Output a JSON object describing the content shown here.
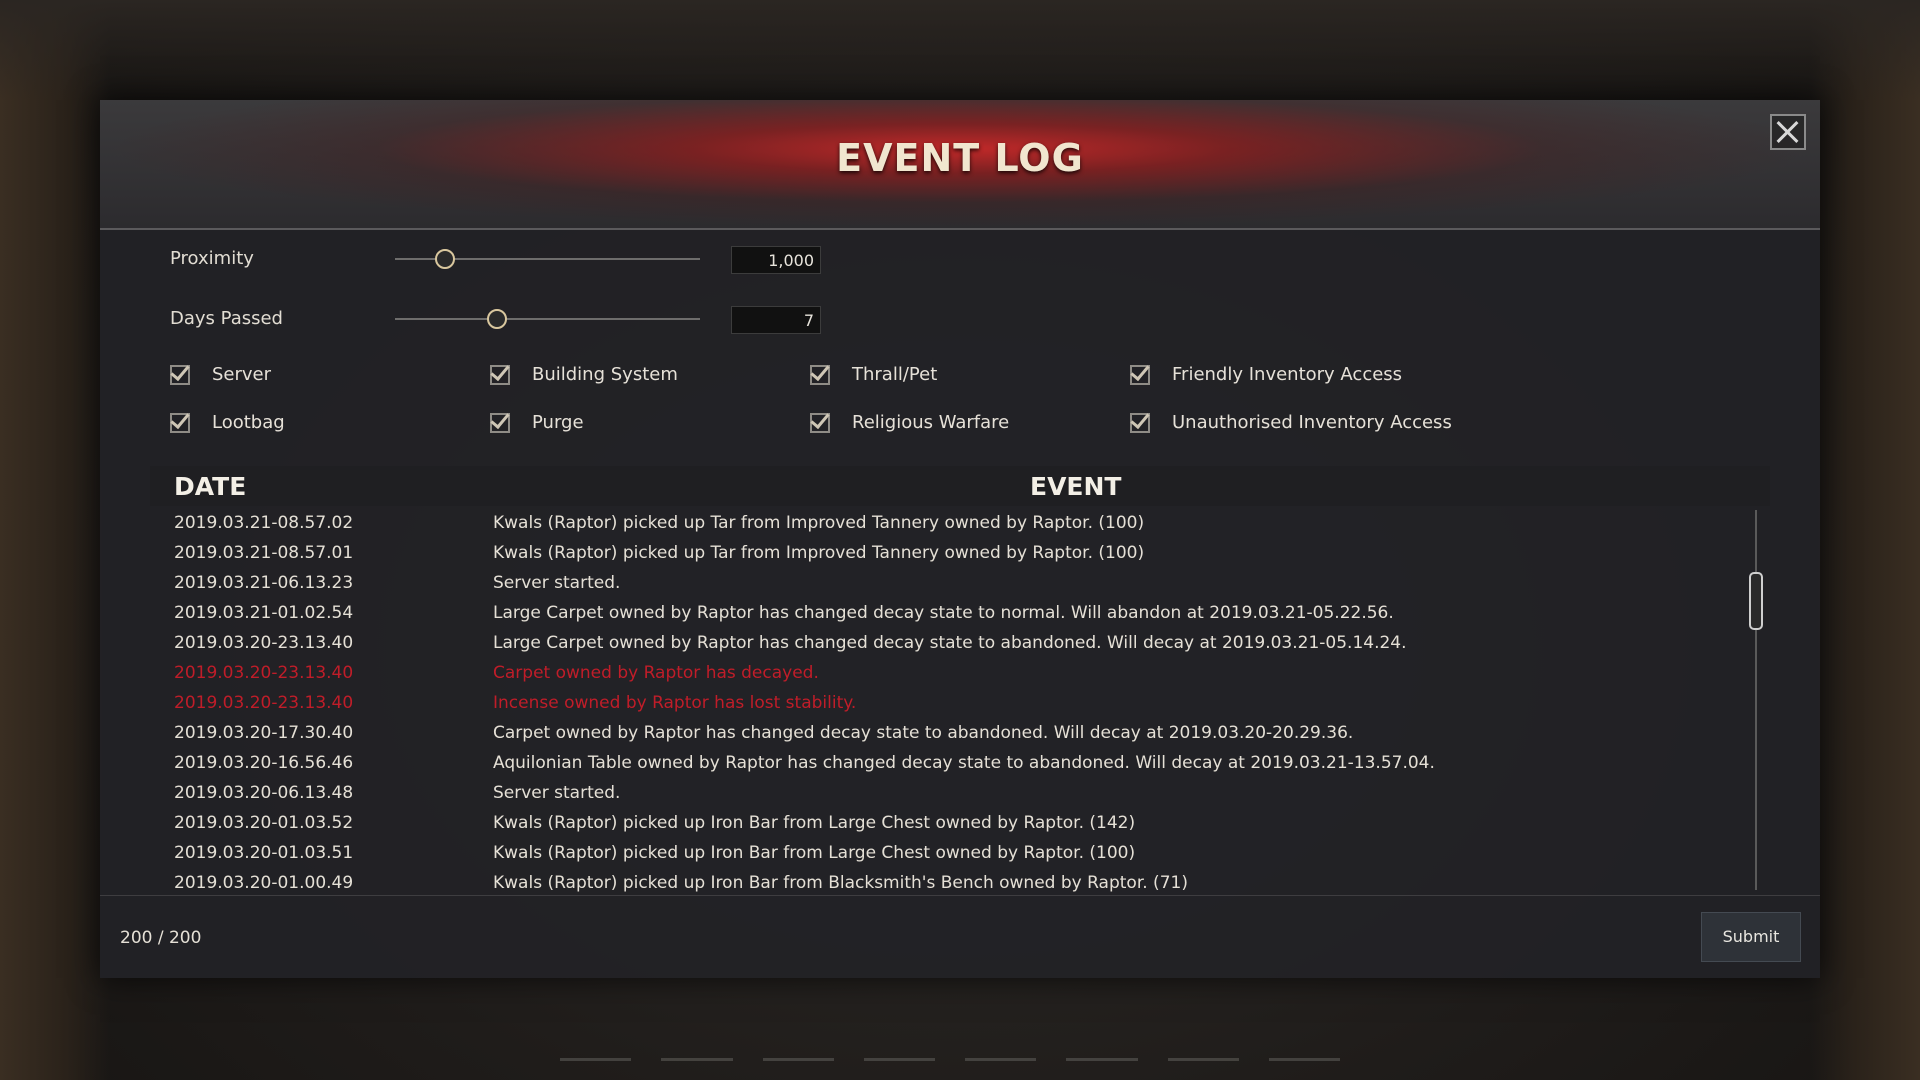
{
  "window": {
    "title": "EVENT LOG"
  },
  "filters": {
    "proximity": {
      "label": "Proximity",
      "value": "1,000",
      "slider_fraction": 0.16
    },
    "days_passed": {
      "label": "Days Passed",
      "value": "7",
      "slider_fraction": 0.33
    }
  },
  "checkboxes": [
    {
      "label": "Server",
      "checked": true
    },
    {
      "label": "Building System",
      "checked": true
    },
    {
      "label": "Thrall/Pet",
      "checked": true
    },
    {
      "label": "Friendly Inventory Access",
      "checked": true
    },
    {
      "label": "Lootbag",
      "checked": true
    },
    {
      "label": "Purge",
      "checked": true
    },
    {
      "label": "Religious Warfare",
      "checked": true
    },
    {
      "label": "Unauthorised Inventory Access",
      "checked": true
    }
  ],
  "table": {
    "col_date": "DATE",
    "col_event": "EVENT",
    "rows": [
      {
        "date": "2019.03.21-08.57.02",
        "event": "Kwals (Raptor) picked up Tar from Improved Tannery owned by Raptor. (100)",
        "alert": false
      },
      {
        "date": "2019.03.21-08.57.01",
        "event": "Kwals (Raptor) picked up Tar from Improved Tannery owned by Raptor. (100)",
        "alert": false
      },
      {
        "date": "2019.03.21-06.13.23",
        "event": "Server started.",
        "alert": false
      },
      {
        "date": "2019.03.21-01.02.54",
        "event": "Large Carpet owned by Raptor has changed decay state to normal. Will abandon at 2019.03.21-05.22.56.",
        "alert": false
      },
      {
        "date": "2019.03.20-23.13.40",
        "event": "Large Carpet owned by Raptor has changed decay state to abandoned. Will decay at 2019.03.21-05.14.24.",
        "alert": false
      },
      {
        "date": "2019.03.20-23.13.40",
        "event": "Carpet owned by Raptor has decayed.",
        "alert": true
      },
      {
        "date": "2019.03.20-23.13.40",
        "event": "Incense owned by Raptor has lost stability.",
        "alert": true
      },
      {
        "date": "2019.03.20-17.30.40",
        "event": "Carpet owned by Raptor has changed decay state to abandoned. Will decay at 2019.03.20-20.29.36.",
        "alert": false
      },
      {
        "date": "2019.03.20-16.56.46",
        "event": "Aquilonian Table owned by Raptor has changed decay state to abandoned. Will decay at 2019.03.21-13.57.04.",
        "alert": false
      },
      {
        "date": "2019.03.20-06.13.48",
        "event": "Server started.",
        "alert": false
      },
      {
        "date": "2019.03.20-01.03.52",
        "event": "Kwals (Raptor) picked up Iron Bar from Large Chest owned by Raptor. (142)",
        "alert": false
      },
      {
        "date": "2019.03.20-01.03.51",
        "event": "Kwals (Raptor) picked up Iron Bar from Large Chest owned by Raptor. (100)",
        "alert": false
      },
      {
        "date": "2019.03.20-01.00.49",
        "event": "Kwals (Raptor) picked up Iron Bar from Blacksmith's Bench owned by Raptor. (71)",
        "alert": false
      }
    ]
  },
  "footer": {
    "count": "200 / 200",
    "submit_label": "Submit"
  },
  "colors": {
    "alert_text": "#c01d29",
    "header_accent": "#c82828"
  }
}
